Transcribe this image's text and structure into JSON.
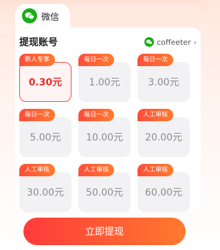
{
  "tab": {
    "label": "微信"
  },
  "header": {
    "title": "提现账号",
    "account_name": "coffeeter"
  },
  "amounts": [
    {
      "tag": "新人专享",
      "value": "0.30元",
      "selected": true
    },
    {
      "tag": "每日一次",
      "value": "1.00元",
      "selected": false
    },
    {
      "tag": "每日一次",
      "value": "3.00元",
      "selected": false
    },
    {
      "tag": "每日一次",
      "value": "5.00元",
      "selected": false
    },
    {
      "tag": "每日一次",
      "value": "10.00元",
      "selected": false
    },
    {
      "tag": "人工审核",
      "value": "20.00元",
      "selected": false
    },
    {
      "tag": "人工审核",
      "value": "30.00元",
      "selected": false
    },
    {
      "tag": "人工审核",
      "value": "50.00元",
      "selected": false
    },
    {
      "tag": "人工审核",
      "value": "60.00元",
      "selected": false
    }
  ],
  "submit": {
    "label": "立即提现"
  },
  "colors": {
    "accent": "#ff4d3a",
    "wechat_green": "#1aad19",
    "selected_text": "#e5302b"
  }
}
